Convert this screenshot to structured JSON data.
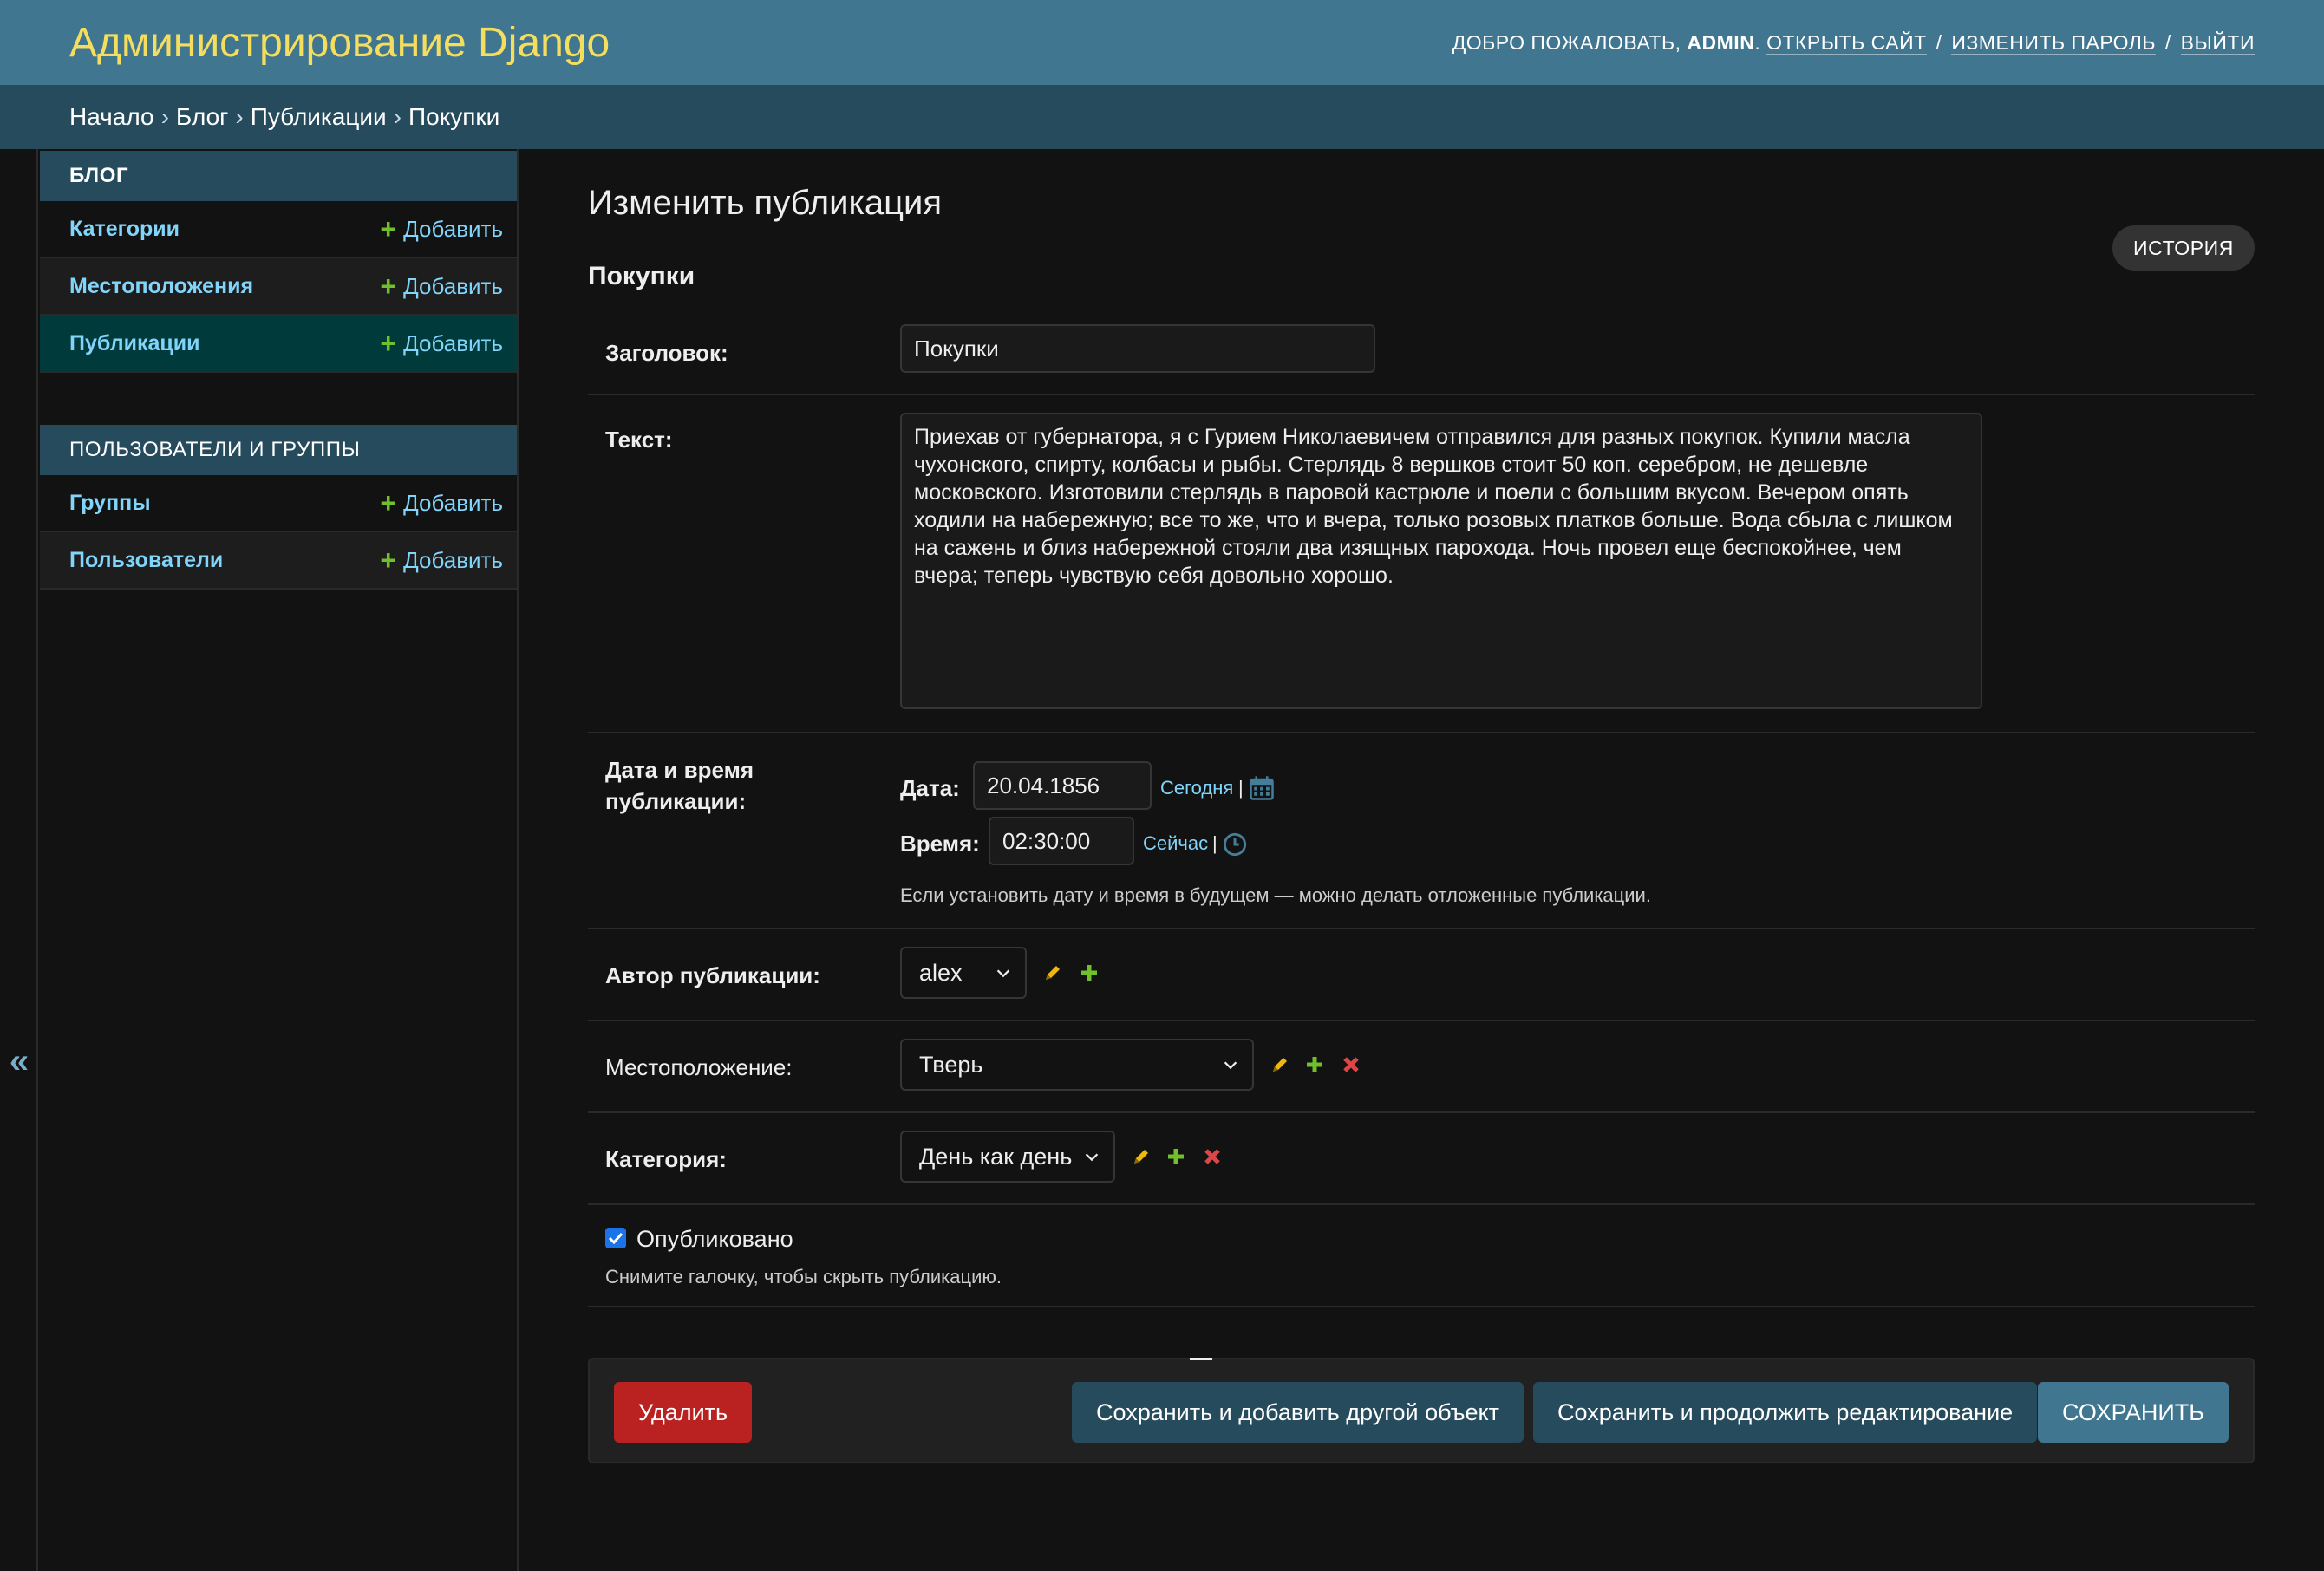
{
  "header": {
    "site_name": "Администрирование Django",
    "welcome": "Добро пожаловать,",
    "username": "admin",
    "view_site": "Открыть сайт",
    "change_password": "Изменить пароль",
    "logout": "Выйти",
    "separator": "/"
  },
  "breadcrumbs": {
    "home": "Начало",
    "app": "Блог",
    "model": "Публикации",
    "current": "Покупки",
    "separator": "›"
  },
  "sidebar": {
    "toggle_glyph": "«",
    "modules": [
      {
        "caption": "Блог",
        "models": [
          {
            "name": "Категории",
            "add": "Добавить"
          },
          {
            "name": "Местоположения",
            "add": "Добавить"
          },
          {
            "name": "Публикации",
            "add": "Добавить"
          }
        ]
      },
      {
        "caption": "Пользователи и группы",
        "models": [
          {
            "name": "Группы",
            "add": "Добавить"
          },
          {
            "name": "Пользователи",
            "add": "Добавить"
          }
        ]
      }
    ]
  },
  "content": {
    "page_title": "Изменить публикация",
    "history": "История",
    "object_name": "Покупки",
    "fields": {
      "title": {
        "label": "Заголовок:",
        "value": "Покупки"
      },
      "text": {
        "label": "Текст:",
        "value": "Приехав от губернатора, я с Гурием Николаевичем отправился для разных покупок. Купили масла чухонского, спирту, колбасы и рыбы. Стерлядь 8 вершков стоит 50 коп. серебром, не дешевле московского. Изготовили стерлядь в паровой кастрюле и поели с большим вкусом. Вечером опять ходили на набережную; все то же, что и вчера, только розовых платков больше. Вода сбыла с лишком на сажень и близ набережной стояли два изящных парохода. Ночь провел еще беспокойнее, чем вчера; теперь чувствую себя довольно хорошо."
      },
      "pub_date": {
        "label": "Дата и время публикации:",
        "date_label": "Дата:",
        "date_value": "20.04.1856",
        "today": "Сегодня",
        "time_label": "Время:",
        "time_value": "02:30:00",
        "now": "Сейчас",
        "pipe": "|",
        "help": "Если установить дату и время в будущем — можно делать отложенные публикации."
      },
      "author": {
        "label": "Автор публикации:",
        "value": "alex"
      },
      "location": {
        "label": "Местоположение:",
        "value": "Тверь"
      },
      "category": {
        "label": "Категория:",
        "value": "День как день"
      },
      "is_published": {
        "label": "Опубликовано",
        "checked": true,
        "help": "Снимите галочку, чтобы скрыть публикацию."
      }
    }
  },
  "submit": {
    "delete": "Удалить",
    "save_add": "Сохранить и добавить другой объект",
    "save_continue": "Сохранить и продолжить редактирование",
    "save": "Сохранить"
  },
  "colors": {
    "header_bg": "#417690",
    "breadcrumbs_bg": "#264b5d",
    "site_name": "#f5dd5d",
    "link": "#81d4fa",
    "add_icon": "#70bf2b",
    "change_icon": "#efb80b",
    "delete_icon": "#dd4646",
    "delete_button": "#ba2121"
  }
}
